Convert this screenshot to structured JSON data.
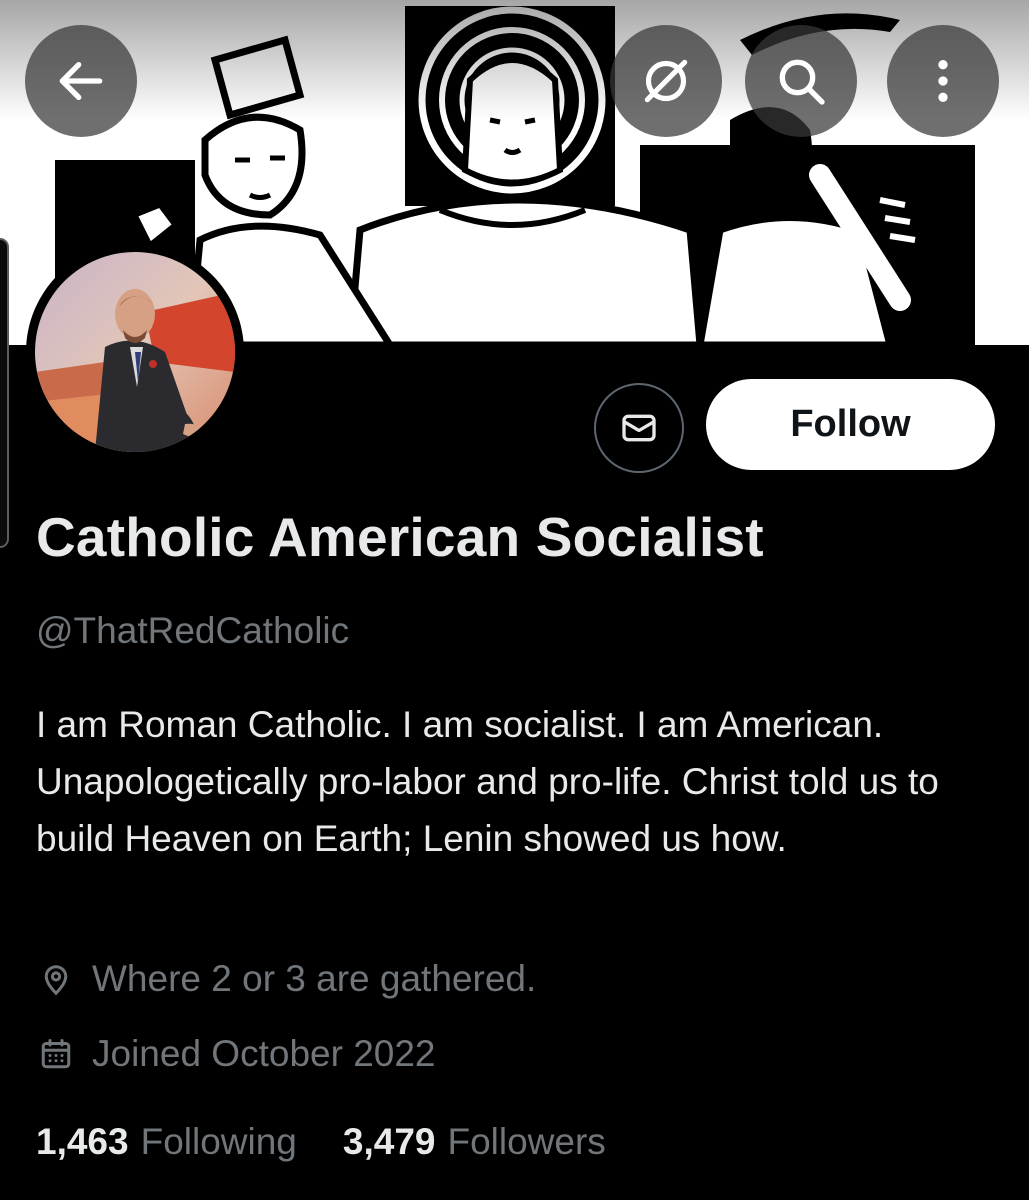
{
  "header": {
    "back_icon": "arrow-left-icon",
    "grok_icon": "grok-icon",
    "search_icon": "search-icon",
    "more_icon": "more-vertical-icon"
  },
  "profile": {
    "display_name": "Catholic American Socialist",
    "handle": "@ThatRedCatholic",
    "bio": "I am Roman Catholic. I am socialist. I am American. Unapologetically pro-labor and pro-life. Christ told us to build Heaven on Earth; Lenin showed us how.",
    "location": "Where 2 or 3 are gathered.",
    "joined": "Joined October 2022"
  },
  "actions": {
    "message_icon": "envelope-icon",
    "follow_label": "Follow"
  },
  "stats": {
    "following_count": "1,463",
    "following_label": "Following",
    "followers_count": "3,479",
    "followers_label": "Followers"
  },
  "colors": {
    "background": "#000000",
    "text_primary": "#e7e9ea",
    "text_secondary": "#71767b",
    "follow_button_bg": "#ffffff",
    "follow_button_text": "#0f1419"
  }
}
